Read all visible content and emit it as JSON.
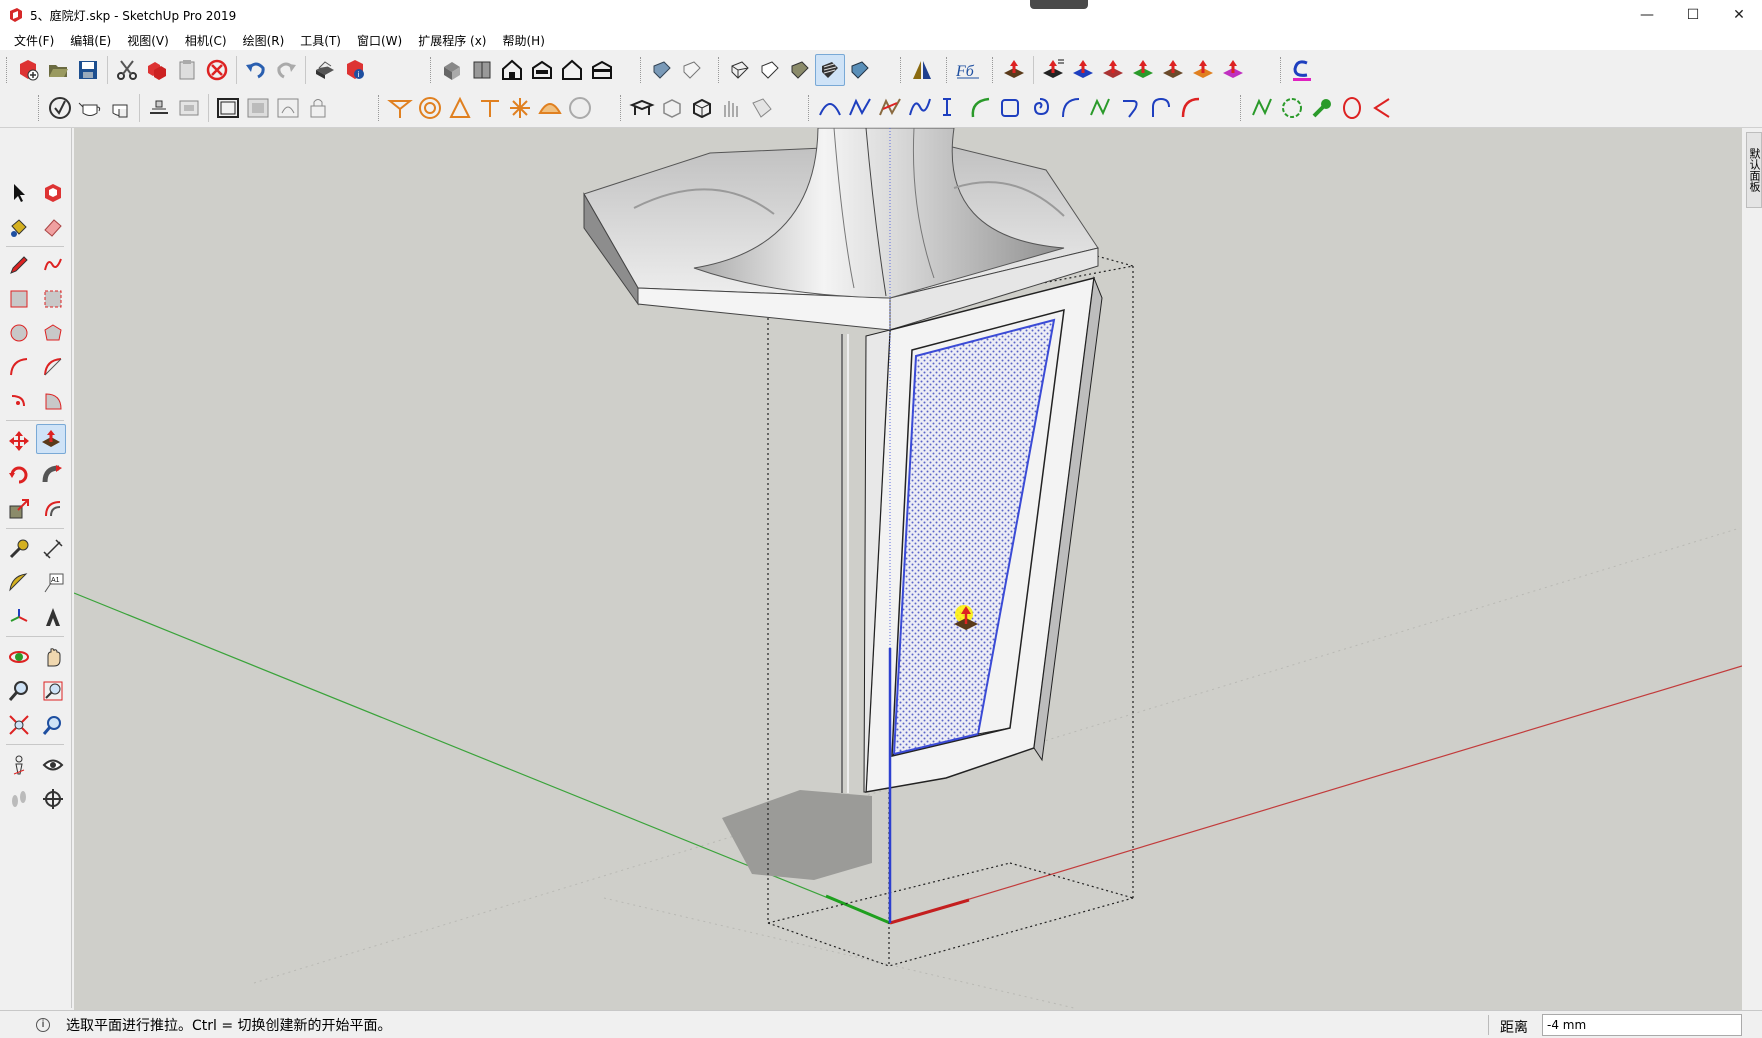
{
  "window": {
    "title": "5、庭院灯.skp - SketchUp Pro 2019",
    "minimize_glyph": "—",
    "maximize_glyph": "☐",
    "close_glyph": "✕"
  },
  "menu": {
    "items": [
      "文件(F)",
      "编辑(E)",
      "视图(V)",
      "相机(C)",
      "绘图(R)",
      "工具(T)",
      "窗口(W)",
      "扩展程序 (x)",
      "帮助(H)"
    ]
  },
  "toolbar_main": {
    "icons": [
      "new-model-icon",
      "open-icon",
      "save-icon",
      "cut-icon",
      "copy-icon",
      "paste-icon",
      "erase-selection-icon",
      "undo-icon",
      "redo-icon",
      "print-icon",
      "model-info-icon",
      "iso-view-icon",
      "top-view-icon",
      "front-view-icon",
      "right-view-icon",
      "back-view-icon",
      "left-view-icon",
      "xray-style-icon",
      "back-edges-icon",
      "wireframe-icon",
      "hidden-line-icon",
      "shaded-icon",
      "shaded-textures-icon",
      "monochrome-icon",
      "section-plane-icon",
      "font-plugin-icon",
      "pushpull-ext-icon",
      "push-equal-icon",
      "push-j-icon",
      "push-r-icon",
      "push-v-icon",
      "push-n-icon",
      "push-x-icon",
      "push-f-icon",
      "curvizard-icon"
    ],
    "labels": {
      "font_plugin": "Fб"
    }
  },
  "toolbar_second": {
    "icons": [
      "solid-check-icon",
      "teapot-icon",
      "teapot-hand-icon",
      "sandbox-from-contours-icon",
      "sandbox-from-scratch-icon",
      "frame-icon",
      "frame-2-icon",
      "frame-3-icon",
      "lock-icon",
      "umbrella-icon",
      "round-corner-icon",
      "bevel-icon",
      "t-shape-icon",
      "sparkle-icon",
      "dome-icon",
      "sphere-icon",
      "table-icon",
      "box-outline-icon",
      "box-3d-icon",
      "hands-icon",
      "fold-icon",
      "bezier-icon",
      "spline-icon",
      "freehand-curve-icon",
      "polyline-icon",
      "catenary-icon",
      "arc-green-icon",
      "rectangle-icon",
      "spiral-icon",
      "arc-icon",
      "zigzag-icon",
      "hook-icon",
      "arc-2-icon",
      "arc-red-icon",
      "edit-curve-icon",
      "polygon-icon",
      "wrench-icon",
      "circle-icon",
      "wedge-icon"
    ]
  },
  "left_toolbar": {
    "icons": [
      "select-icon",
      "make-component-icon",
      "paint-bucket-icon",
      "eraser-icon",
      "pencil-icon",
      "freehand-icon",
      "rectangle-tool-icon",
      "rotated-rect-icon",
      "circle-tool-icon",
      "polygon-tool-icon",
      "arc-tool-icon",
      "two-point-arc-icon",
      "three-point-arc-icon",
      "pie-icon",
      "move-icon",
      "push-pull-icon",
      "rotate-icon",
      "follow-me-icon",
      "scale-icon",
      "offset-icon",
      "tape-measure-icon",
      "dimension-icon",
      "protractor-icon",
      "text-icon",
      "axes-icon",
      "3d-text-icon",
      "orbit-icon",
      "pan-icon",
      "zoom-icon",
      "zoom-window-icon",
      "zoom-extents-icon",
      "previous-view-icon",
      "position-camera-icon",
      "look-around-icon",
      "walk-icon",
      "section-tool-icon"
    ],
    "text_label": "A1",
    "active": "push-pull-icon"
  },
  "tray": {
    "tab_label": "默认面板"
  },
  "status": {
    "info_glyph": "i",
    "hint": "选取平面进行推拉。Ctrl = 切换创建新的开始平面。",
    "measure_label": "距离",
    "measure_value": "-4 mm"
  },
  "colors": {
    "viewport_bg": "#cfcfca",
    "axis_red": "#c23b3b",
    "axis_green": "#3aa33a",
    "axis_blue": "#2c3fcf",
    "selection_blue": "#3b4bd6"
  }
}
